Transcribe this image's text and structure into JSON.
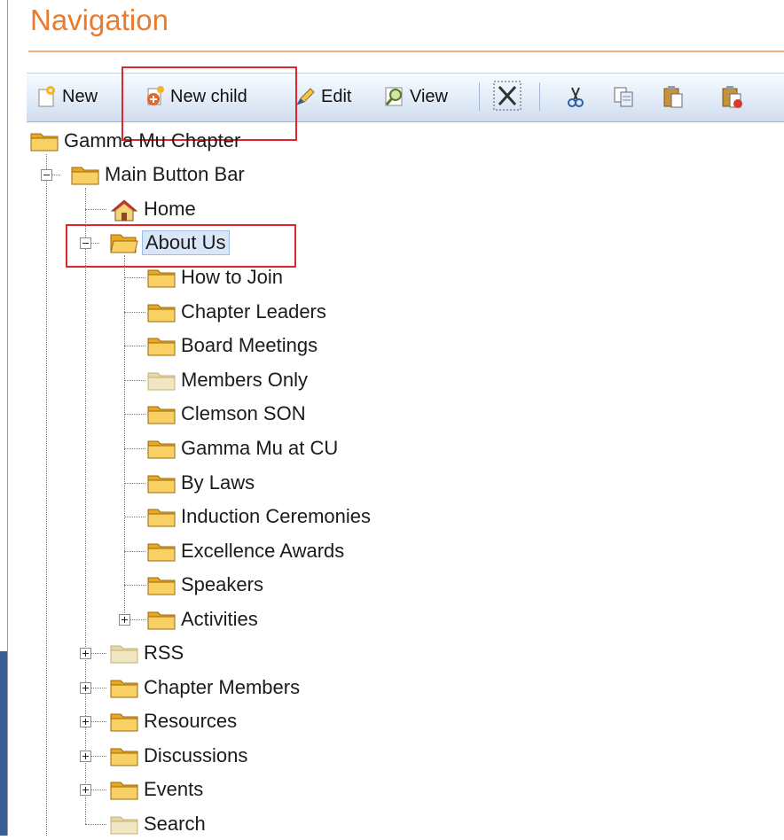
{
  "panel": {
    "title": "Navigation"
  },
  "toolbar": {
    "new_label": "New",
    "new_child_label": "New child",
    "edit_label": "Edit",
    "view_label": "View",
    "icons": [
      "new-page-icon",
      "new-child-icon",
      "edit-pencil-icon",
      "view-magnifier-icon",
      "delete-x-icon",
      "cut-scissors-icon",
      "copy-icon",
      "paste-icon",
      "paste-special-icon"
    ]
  },
  "tree": {
    "root": "Gamma Mu Chapter",
    "main_button_bar": "Main Button Bar",
    "home": "Home",
    "about_us": "About Us",
    "about_children": [
      "How to Join",
      "Chapter Leaders",
      "Board Meetings",
      "Members Only",
      "Clemson SON",
      "Gamma Mu at CU",
      "By Laws",
      "Induction Ceremonies",
      "Excellence Awards",
      "Speakers",
      "Activities"
    ],
    "siblings": [
      "RSS",
      "Chapter Members",
      "Resources",
      "Discussions",
      "Events",
      "Search"
    ]
  },
  "colors": {
    "title": "#ea7a2c",
    "highlight": "#e0262b",
    "folder": "#f5c84a",
    "folder_faded": "#eee0b4"
  }
}
